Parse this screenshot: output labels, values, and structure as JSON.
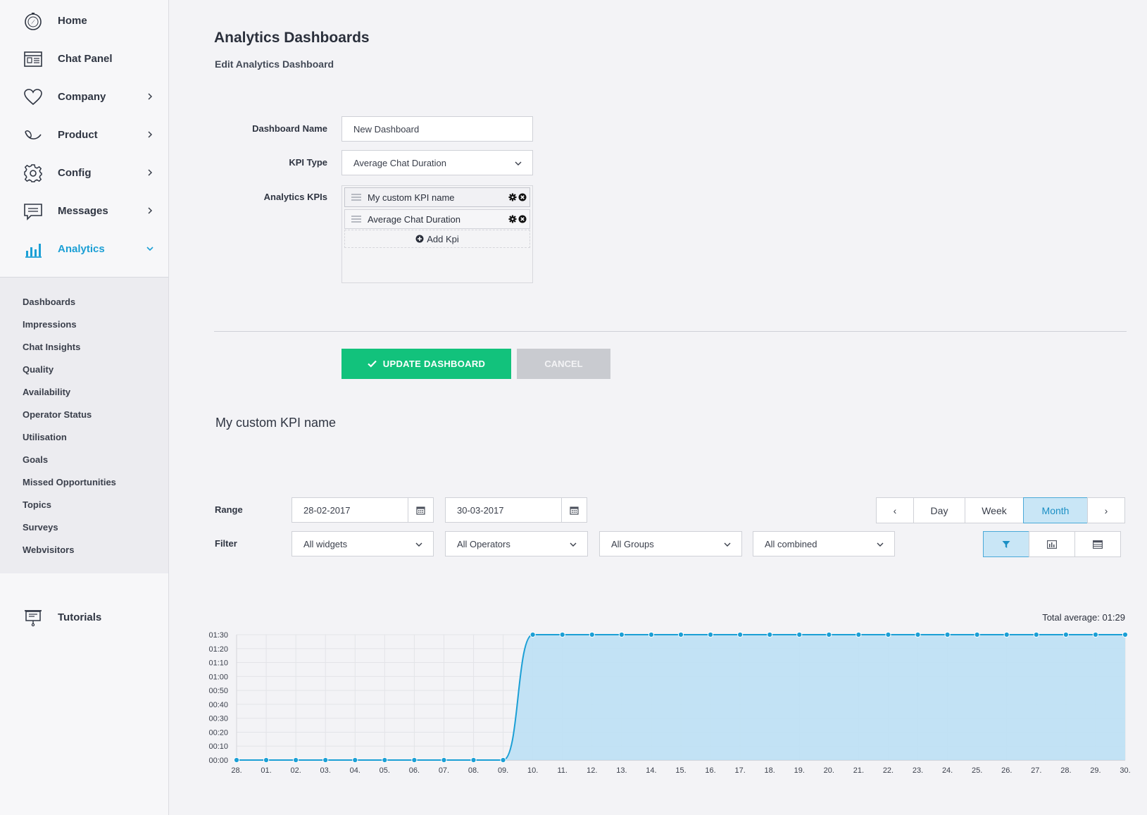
{
  "sidebar": {
    "items": [
      {
        "label": "Home",
        "icon": "compass-icon"
      },
      {
        "label": "Chat Panel",
        "icon": "chat-panel-icon"
      },
      {
        "label": "Company",
        "icon": "heart-icon"
      },
      {
        "label": "Product",
        "icon": "product-icon"
      },
      {
        "label": "Config",
        "icon": "gear-icon"
      },
      {
        "label": "Messages",
        "icon": "message-icon"
      },
      {
        "label": "Analytics",
        "icon": "bar-chart-icon"
      }
    ],
    "sub_items": [
      "Dashboards",
      "Impressions",
      "Chat Insights",
      "Quality",
      "Availability",
      "Operator Status",
      "Utilisation",
      "Goals",
      "Missed Opportunities",
      "Topics",
      "Surveys",
      "Webvisitors"
    ],
    "tutorials": "Tutorials",
    "accent_color": "#1b9fd5"
  },
  "header": {
    "title": "Analytics Dashboards",
    "subtitle": "Edit Analytics Dashboard"
  },
  "form": {
    "dashboard_name_label": "Dashboard Name",
    "dashboard_name_value": "New Dashboard",
    "kpi_type_label": "KPI Type",
    "kpi_type_value": "Average Chat Duration",
    "analytics_kpis_label": "Analytics KPIs",
    "kpis": [
      "My custom KPI name",
      "Average Chat Duration"
    ],
    "add_kpi_label": "Add Kpi",
    "update_label": "UPDATE DASHBOARD",
    "cancel_label": "CANCEL",
    "update_color": "#12c27c"
  },
  "kpi_panel": {
    "title": "My custom KPI name",
    "range_label": "Range",
    "range_from": "28-02-2017",
    "range_to": "30-03-2017",
    "filter_label": "Filter",
    "filters": [
      "All widgets",
      "All Operators",
      "All Groups",
      "All combined"
    ],
    "periods": {
      "prev": "‹",
      "day": "Day",
      "week": "Week",
      "month": "Month",
      "next": "›"
    },
    "active_period": "Month",
    "views": [
      "filter-icon",
      "bar-chart-icon",
      "table-icon"
    ],
    "total_average": "Total average: 01:29"
  },
  "chart_data": {
    "type": "area",
    "x": [
      "28.",
      "01.",
      "02.",
      "03.",
      "04.",
      "05.",
      "06.",
      "07.",
      "08.",
      "09.",
      "10.",
      "11.",
      "12.",
      "13.",
      "14.",
      "15.",
      "16.",
      "17.",
      "18.",
      "19.",
      "20.",
      "21.",
      "22.",
      "23.",
      "24.",
      "25.",
      "26.",
      "27.",
      "28.",
      "29.",
      "30."
    ],
    "y_ticks": [
      "00:00",
      "00:10",
      "00:20",
      "00:30",
      "00:40",
      "00:50",
      "01:00",
      "01:10",
      "01:20",
      "01:30"
    ],
    "ylim": [
      0,
      90
    ],
    "values": [
      0,
      0,
      0,
      0,
      0,
      0,
      0,
      0,
      0,
      0,
      90,
      90,
      90,
      90,
      90,
      90,
      90,
      90,
      90,
      90,
      90,
      90,
      90,
      90,
      90,
      90,
      90,
      90,
      90,
      90,
      90
    ],
    "line_color": "#1b9fd5",
    "fill_color": "#bde0f5",
    "grid": true
  }
}
